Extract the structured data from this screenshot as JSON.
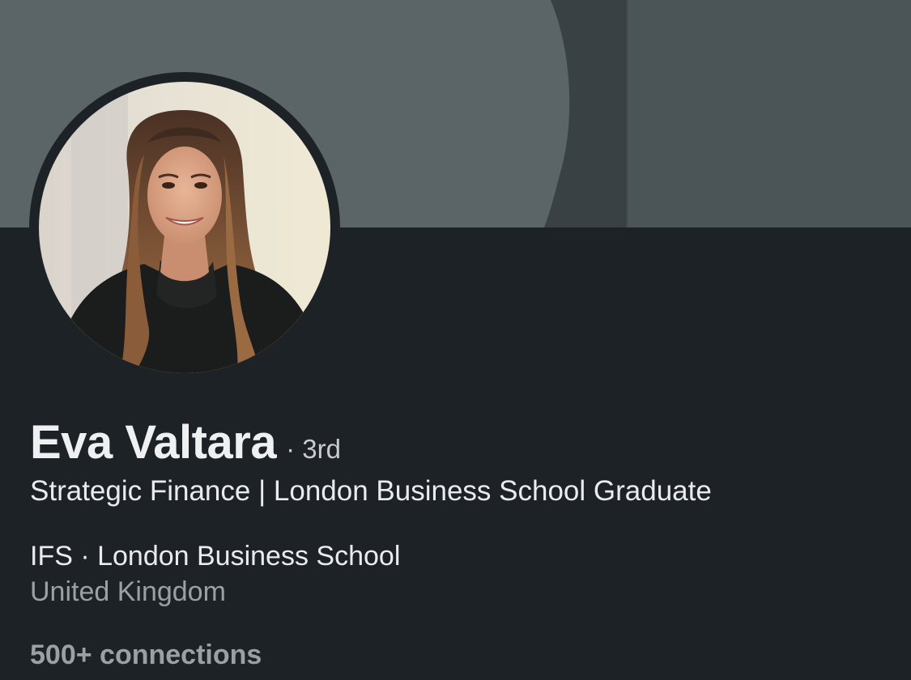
{
  "profile": {
    "name": "Eva Valtara",
    "degree": "· 3rd",
    "headline": "Strategic Finance | London Business School Graduate",
    "company_education": "IFS · London Business School",
    "location": "United Kingdom",
    "connections": "500+ connections"
  },
  "colors": {
    "background": "#1d2226",
    "banner_main": "#5b6568",
    "banner_dark": "#3a4144",
    "banner_right": "#4b5457",
    "primary_text": "#e9ebed",
    "secondary_text": "#9aa0a5"
  },
  "icons": {
    "avatar": "profile-photo"
  }
}
